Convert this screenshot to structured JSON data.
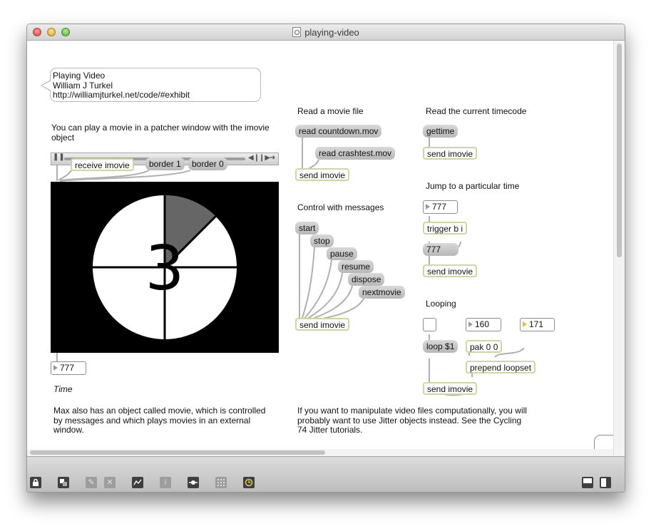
{
  "window": {
    "title": "playing-video",
    "controls": [
      "close-button",
      "minimize-button",
      "zoom-button"
    ]
  },
  "comment_bubble": {
    "line1": "Playing Video",
    "line2": "William J Turkel",
    "line3": "http://williamjturkel.net/code/#exhibit"
  },
  "comments": {
    "intro_line1": "You can play a movie in a patcher window with the imovie",
    "intro_line2": "object",
    "read_movie": "Read a movie file",
    "read_timecode": "Read the current timecode",
    "jump_time": "Jump to a particular time",
    "control_messages": "Control with messages",
    "looping": "Looping",
    "time": "Time",
    "max_movie_line1": "Max also has an object called movie, which is controlled",
    "max_movie_line2": "by messages and which plays movies in an external",
    "max_movie_line3": "window.",
    "jitter_line1": "If you want to manipulate video files computationally, you will",
    "jitter_line2": "probably want to use Jitter objects instead. See the Cycling",
    "jitter_line3": "74 Jitter tutorials."
  },
  "movie_frame": {
    "number": "3",
    "colors": {
      "background": "#000000",
      "dial": "#ffffff",
      "sweep": "#666666",
      "lines": "#000000"
    }
  },
  "messages": {
    "border_1": "border 1",
    "border_0": "border 0",
    "read_countdown": "read countdown.mov",
    "read_crashtest": "read crashtest.mov",
    "start": "start",
    "stop": "stop",
    "pause": "pause",
    "resume": "resume",
    "dispose": "dispose",
    "nextmovie": "nextmovie",
    "gettime": "gettime",
    "value_777": "777",
    "loop": "loop $1"
  },
  "objects": {
    "receive_imovie": "receive imovie",
    "send_imovie": "send imovie",
    "trigger": "trigger b i",
    "pak": "pak 0 0",
    "prepend": "prepend loopset"
  },
  "number_boxes": {
    "time_out": "777",
    "jump_in": "777",
    "loop_start": "160",
    "loop_end": "171"
  },
  "toolbar": {
    "left_icons": [
      "lock-icon",
      "presentation-icon",
      "new-object-icon",
      "delete-icon",
      "inspector-toggle-icon",
      "info-icon",
      "snap-icon",
      "grid-icon",
      "debug-icon"
    ],
    "right_icons": [
      "split-horizontal-icon",
      "split-vertical-icon"
    ]
  },
  "colors": {
    "object_border": "#cbd7a4",
    "message_fill": "#c8c8c8",
    "patch_cord": "#b0b0b0",
    "toolbar": "#cfcfcf"
  }
}
